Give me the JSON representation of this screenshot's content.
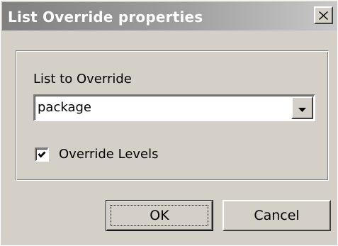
{
  "window": {
    "title": "List Override properties",
    "close_icon": "close-icon"
  },
  "form": {
    "list_label": "List to Override",
    "list_value": "package",
    "dropdown_icon": "chevron-down-icon",
    "checkbox_label": "Override Levels",
    "checkbox_checked": true
  },
  "buttons": {
    "ok_label": "OK",
    "cancel_label": "Cancel"
  }
}
